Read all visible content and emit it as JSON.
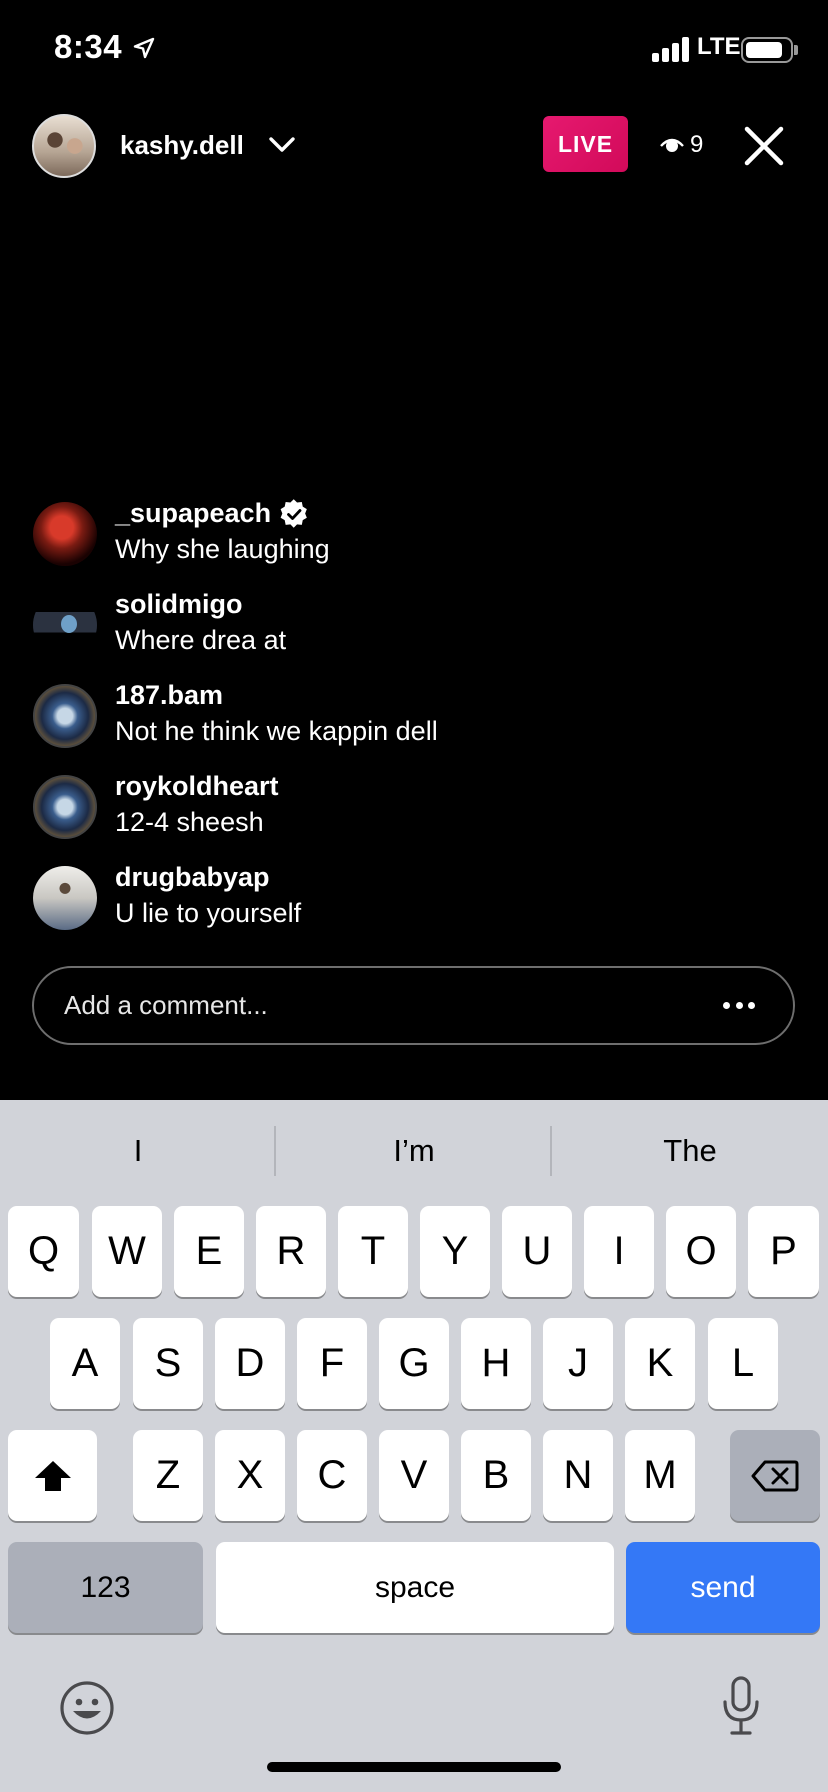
{
  "status_bar": {
    "time": "8:34",
    "network": "LTE",
    "battery_level": 0.85
  },
  "header": {
    "username": "kashy.dell",
    "live_label": "LIVE",
    "viewer_count": "9",
    "accent_color": "#E0126A"
  },
  "comments": [
    {
      "user": "_supapeach",
      "verified": true,
      "text": "Why she laughing"
    },
    {
      "user": "solidmigo",
      "verified": false,
      "text": "Where drea at"
    },
    {
      "user": "187.bam",
      "verified": false,
      "text": "Not he think we kappin dell"
    },
    {
      "user": "roykoldheart",
      "verified": false,
      "text": "12-4 sheesh"
    },
    {
      "user": "drugbabyap",
      "verified": false,
      "text": "U lie to yourself"
    }
  ],
  "comment_box": {
    "placeholder": "Add a comment..."
  },
  "keyboard": {
    "suggestions": [
      "I",
      "I’m",
      "The"
    ],
    "row1": [
      "Q",
      "W",
      "E",
      "R",
      "T",
      "Y",
      "U",
      "I",
      "O",
      "P"
    ],
    "row2": [
      "A",
      "S",
      "D",
      "F",
      "G",
      "H",
      "J",
      "K",
      "L"
    ],
    "row3": [
      "Z",
      "X",
      "C",
      "V",
      "B",
      "N",
      "M"
    ],
    "numbers_label": "123",
    "space_label": "space",
    "send_label": "send",
    "send_color": "#3478F6"
  }
}
